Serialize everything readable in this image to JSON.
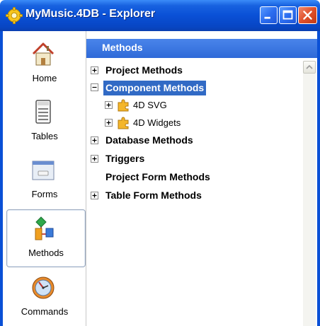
{
  "window": {
    "title": "MyMusic.4DB - Explorer",
    "title_bar_color": "#0a50d6"
  },
  "sidebar": {
    "items": [
      {
        "label": "Home",
        "icon": "home-icon"
      },
      {
        "label": "Tables",
        "icon": "tables-icon"
      },
      {
        "label": "Forms",
        "icon": "forms-icon"
      },
      {
        "label": "Methods",
        "icon": "methods-icon",
        "selected": true
      },
      {
        "label": "Commands",
        "icon": "commands-icon"
      }
    ]
  },
  "panel": {
    "header": "Methods",
    "header_color": "#2f6ad8",
    "tree": [
      {
        "label": "Project Methods",
        "expander": "+",
        "level": 0
      },
      {
        "label": "Component Methods",
        "expander": "-",
        "level": 0,
        "selected": true
      },
      {
        "label": "4D SVG",
        "expander": "+",
        "level": 1,
        "icon": "puzzle-icon"
      },
      {
        "label": "4D Widgets",
        "expander": "+",
        "level": 1,
        "icon": "puzzle-icon"
      },
      {
        "label": "Database Methods",
        "expander": "+",
        "level": 0
      },
      {
        "label": "Triggers",
        "expander": "+",
        "level": 0
      },
      {
        "label": "Project Form Methods",
        "expander": "",
        "level": 0
      },
      {
        "label": "Table Form Methods",
        "expander": "+",
        "level": 0
      }
    ],
    "selection_color": "#316ac5"
  }
}
